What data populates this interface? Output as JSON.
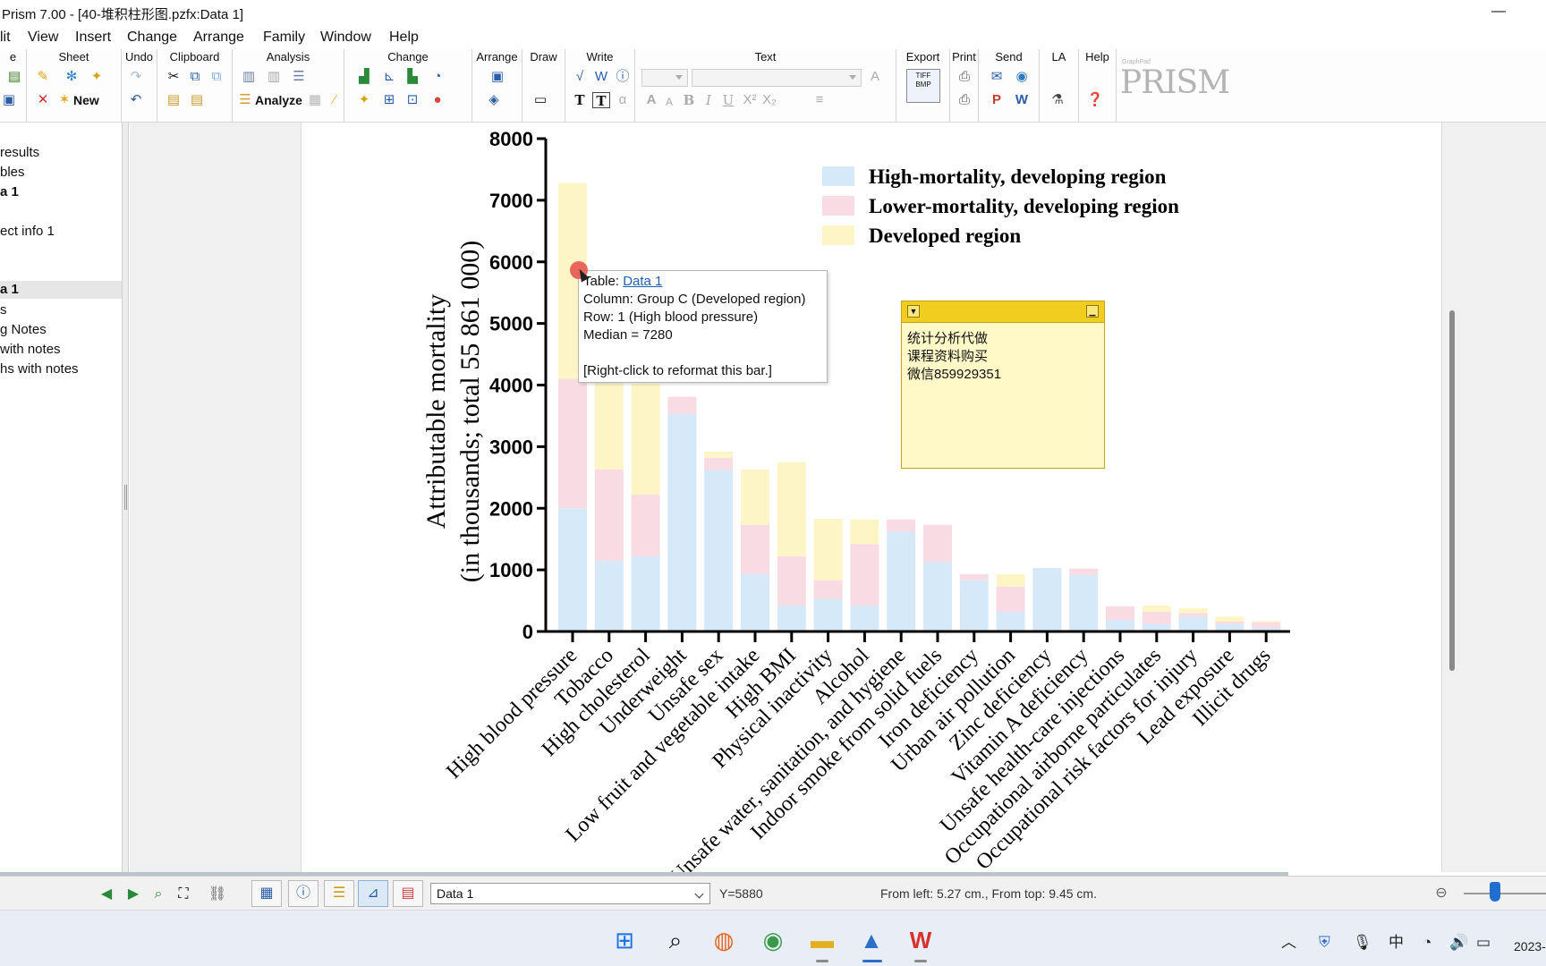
{
  "window": {
    "title": "Prism 7.00 - [40-堆积柱形图.pzfx:Data 1]",
    "minimize_glyph": "—",
    "maximize_glyph": "☐"
  },
  "menu": [
    "lit",
    "View",
    "Insert",
    "Change",
    "Arrange",
    "Family",
    "Window",
    "Help"
  ],
  "toolbar": {
    "groups": [
      "e",
      "Sheet",
      "Undo",
      "Clipboard",
      "Analysis",
      "Change",
      "Arrange",
      "Draw",
      "Write",
      "Text",
      "Export",
      "Print",
      "Send",
      "LA",
      "Help"
    ],
    "new_label": "New",
    "analyze_label": "Analyze",
    "export_badge": "TIFF BMP",
    "logo_text": "PRISM",
    "logo_small": "GraphPad"
  },
  "navigator": {
    "items": [
      {
        "label": "results",
        "bold": false,
        "selected": false
      },
      {
        "label": "bles",
        "bold": false,
        "selected": false
      },
      {
        "label": "a 1",
        "bold": true,
        "selected": false
      },
      {
        "label": "ect info 1",
        "bold": false,
        "selected": false
      },
      {
        "label": "a 1",
        "bold": true,
        "selected": true
      },
      {
        "label": "s",
        "bold": false,
        "selected": false
      },
      {
        "label": "g Notes",
        "bold": false,
        "selected": false
      },
      {
        "label": " with notes",
        "bold": false,
        "selected": false
      },
      {
        "label": "hs with notes",
        "bold": false,
        "selected": false
      }
    ]
  },
  "chart_data": {
    "type": "bar",
    "stacked": true,
    "ylabel": [
      "Attributable mortality",
      "(in thousands; total 55 861 000)"
    ],
    "ylim": [
      0,
      8000
    ],
    "yticks": [
      0,
      1000,
      2000,
      3000,
      4000,
      5000,
      6000,
      7000,
      8000
    ],
    "legend_position": "top-right",
    "categories": [
      "High blood pressure",
      "Tobacco",
      "High cholesterol",
      "Underweight",
      "Unsafe sex",
      "Low fruit and vegetable intake",
      "High BMI",
      "Physical inactivity",
      "Alcohol",
      "Unsafe water, sanitation, and hygiene",
      "Indoor smoke from solid fuels",
      "Iron deficiency",
      "Urban air pollution",
      "Zinc deficiency",
      "Vitamin A deficiency",
      "Unsafe health-care injections",
      "Occupational airborne particulates",
      "Occupational risk factors for injury",
      "Lead exposure",
      "Illicit drugs"
    ],
    "series": [
      {
        "name": "High-mortality, developing region",
        "color": "#d6e9f8",
        "values": [
          2000,
          1150,
          1220,
          3530,
          2620,
          930,
          420,
          530,
          420,
          1620,
          1130,
          830,
          320,
          1030,
          920,
          190,
          120,
          240,
          120,
          60
        ]
      },
      {
        "name": "Lower-mortality, developing region",
        "color": "#f9dbe3",
        "values": [
          2100,
          1480,
          1000,
          280,
          200,
          800,
          800,
          300,
          1000,
          200,
          600,
          100,
          410,
          0,
          100,
          220,
          200,
          60,
          40,
          90
        ]
      },
      {
        "name": "Developed region",
        "color": "#fdf5c6",
        "values": [
          3180,
          1400,
          1800,
          0,
          100,
          900,
          1530,
          1000,
          400,
          0,
          0,
          0,
          200,
          0,
          0,
          0,
          100,
          80,
          80,
          20
        ]
      }
    ]
  },
  "tooltip": {
    "table_prefix": "Table: ",
    "table_link": "Data 1",
    "column": "Column: Group C (Developed region)",
    "row": "Row: 1 (High blood pressure)",
    "median": "Median = 7280",
    "hint": "[Right-click to reformat this bar.]"
  },
  "sticky_note": {
    "lines": [
      "统计分析代做",
      "课程资料购买",
      "微信859929351"
    ]
  },
  "statusbar": {
    "sheet_select": "Data 1",
    "y_readout": "Y=5880",
    "position": "From left: 5.27 cm., From top: 9.45 cm."
  },
  "taskbar": {
    "ime": "中",
    "clock": "2023-"
  }
}
